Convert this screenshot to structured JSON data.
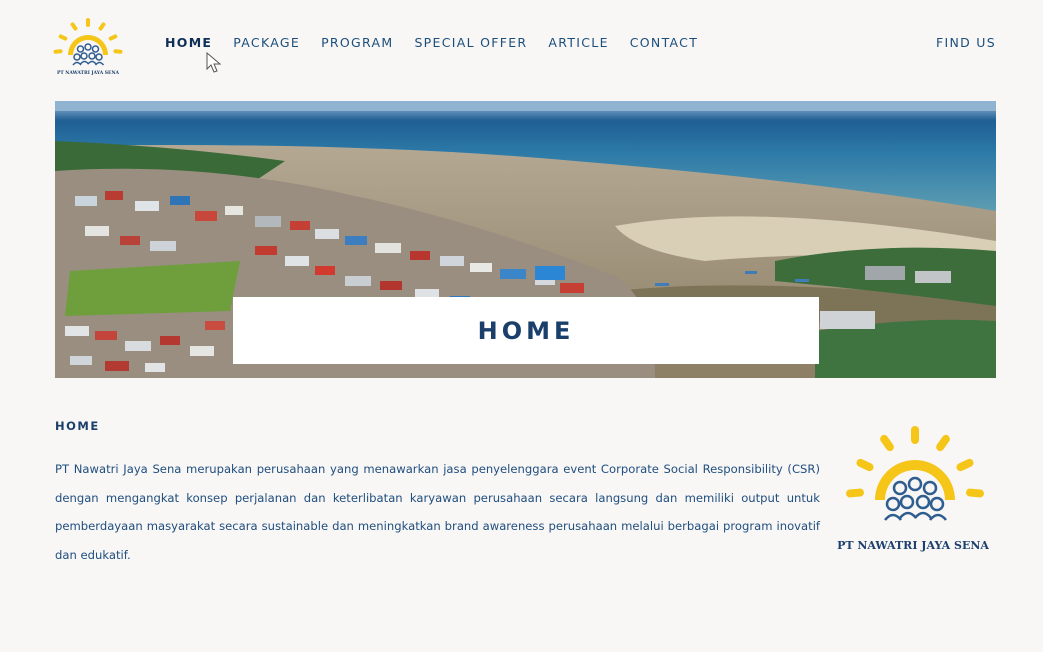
{
  "header": {
    "logo_caption": "PT NAWATRI JAYA SENA",
    "nav": [
      {
        "label": "HOME",
        "active": true
      },
      {
        "label": "PACKAGE",
        "active": false
      },
      {
        "label": "PROGRAM",
        "active": false
      },
      {
        "label": "SPECIAL OFFER",
        "active": false
      },
      {
        "label": "ARTICLE",
        "active": false
      },
      {
        "label": "CONTACT",
        "active": false
      }
    ],
    "find_us": "FIND US"
  },
  "hero": {
    "title": "HOME"
  },
  "content": {
    "heading": "HOME",
    "paragraph": "PT Nawatri Jaya Sena merupakan perusahaan yang menawarkan jasa penyelenggara event Corporate Social Responsibility (CSR) dengan mengangkat konsep perjalanan dan keterlibatan karyawan perusahaan secara langsung dan memiliki output untuk pemberdayaan masyarakat secara sustainable dan meningkatkan brand awareness perusahaan melalui berbagai program inovatif dan edukatif."
  },
  "brand": {
    "name": "PT NAWATRI JAYA SENA",
    "sun_color": "#f5c518",
    "people_color": "#2f5d8f",
    "text_color": "#1c3f6e"
  }
}
